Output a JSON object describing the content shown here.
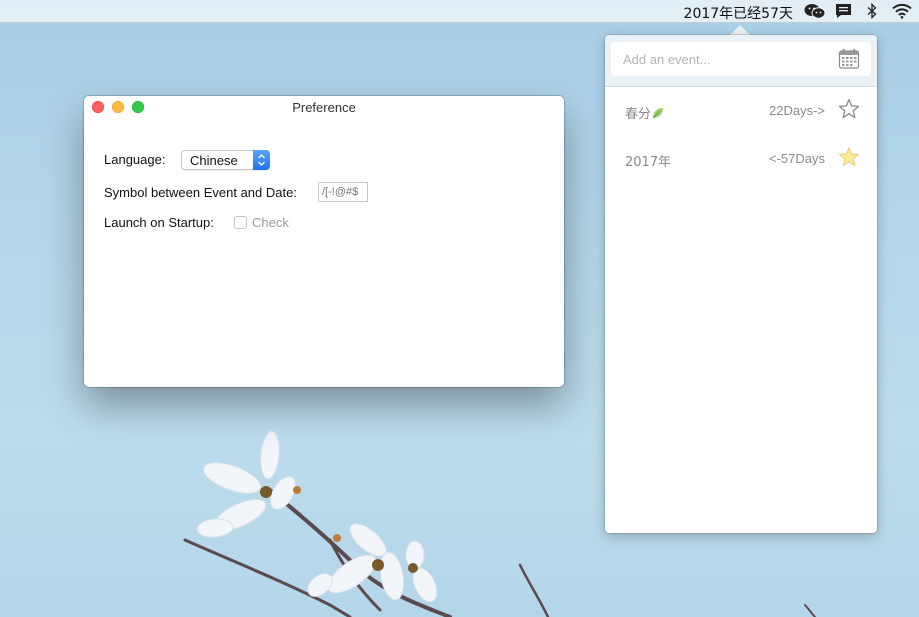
{
  "menubar": {
    "title": "2017年已经57天",
    "icons": [
      "wechat-icon",
      "message-icon",
      "bluetooth-icon",
      "wifi-icon"
    ]
  },
  "popover": {
    "search": {
      "placeholder": "Add an event...",
      "value": ""
    },
    "calendar_icon": "calendar-icon",
    "events": [
      {
        "name": "春分",
        "days": "22Days->",
        "starred": false
      },
      {
        "name": "2017年",
        "days": "<-57Days",
        "starred": true
      }
    ]
  },
  "preference": {
    "title": "Preference",
    "language_label": "Language:",
    "language_value": "Chinese",
    "symbol_label": "Symbol between Event and Date:",
    "symbol_placeholder": "/[-!@#$",
    "startup_label": "Launch on Startup:",
    "startup_check_label": "Check",
    "startup_checked": false
  },
  "colors": {
    "accent": "#1a73f0",
    "star_filled": "#fdeb9a",
    "close": "#fc605b",
    "minimize": "#fdbc40",
    "maximize": "#34c84a"
  }
}
